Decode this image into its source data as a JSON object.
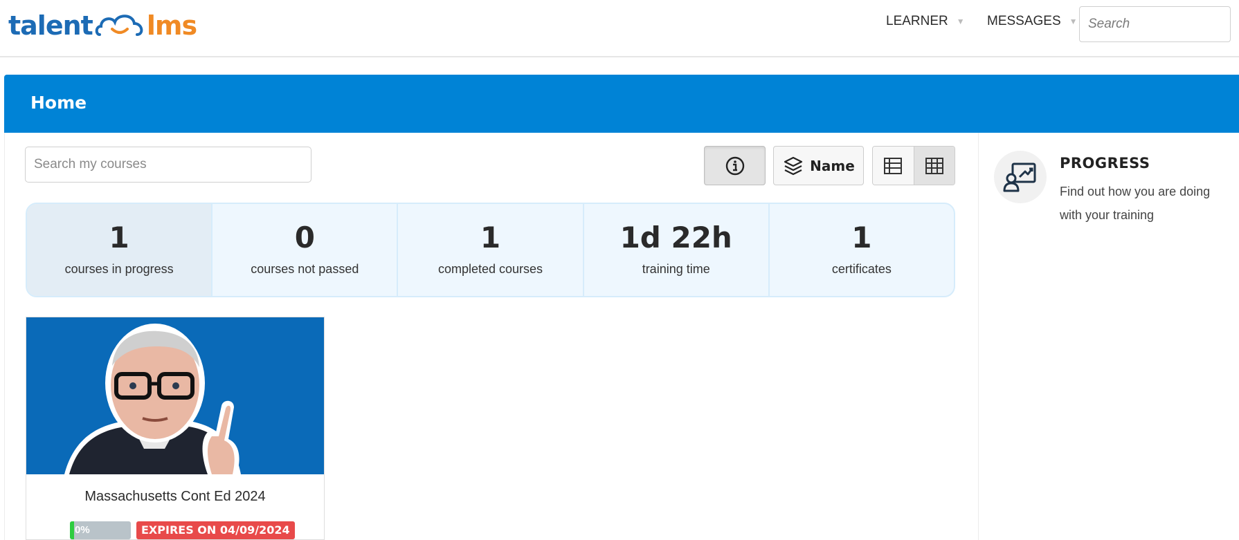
{
  "header": {
    "logo_left": "talent",
    "logo_right": "lms",
    "nav": [
      {
        "label": "LEARNER"
      },
      {
        "label": "MESSAGES"
      }
    ],
    "search_placeholder": "Search"
  },
  "page": {
    "title": "Home"
  },
  "toolbar": {
    "search_placeholder": "Search my courses",
    "sort_label": "Name",
    "info_icon": "info-icon",
    "sort_icon": "layers-icon",
    "list_view_icon": "list-view-icon",
    "grid_view_icon": "grid-view-icon"
  },
  "stats": [
    {
      "value": "1",
      "label": "courses in progress"
    },
    {
      "value": "0",
      "label": "courses not passed"
    },
    {
      "value": "1",
      "label": "completed courses"
    },
    {
      "value": "1d 22h",
      "label": "training time"
    },
    {
      "value": "1",
      "label": "certificates"
    }
  ],
  "courses": [
    {
      "title": "Massachusetts Cont Ed 2024",
      "progress_label": "0%",
      "progress_fraction": 0,
      "expires": "EXPIRES ON 04/09/2024"
    }
  ],
  "sidebar": {
    "progress_title": "PROGRESS",
    "progress_desc": "Find out how you are doing with your training",
    "progress_icon": "progress-chart-icon"
  },
  "colors": {
    "brand_blue": "#0083d6",
    "logo_blue": "#1c6bb5",
    "logo_orange": "#f08a24",
    "expires_red": "#e84a4a",
    "progress_green": "#2ecc40"
  }
}
